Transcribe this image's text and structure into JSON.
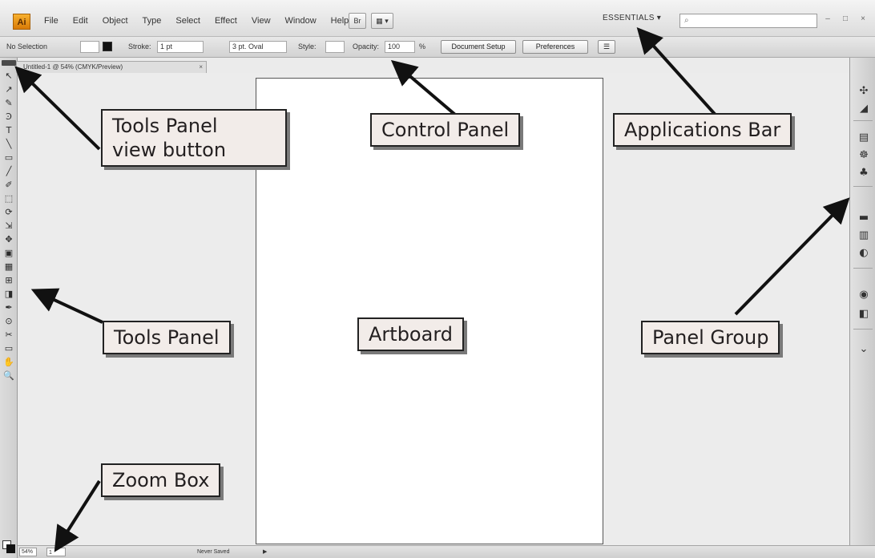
{
  "app": {
    "logo": "Ai",
    "menu": [
      "File",
      "Edit",
      "Object",
      "Type",
      "Select",
      "Effect",
      "View",
      "Window",
      "Help"
    ],
    "bridge_button": "Br",
    "arrange_button": "▦ ▾",
    "workspace": "ESSENTIALS ▾",
    "search_placeholder": "",
    "window_controls": [
      "–",
      "□",
      "×"
    ]
  },
  "control_panel": {
    "selection": "No Selection",
    "stroke_label": "Stroke:",
    "stroke_value": "1 pt",
    "brush": "3 pt. Oval",
    "style_label": "Style:",
    "opacity_label": "Opacity:",
    "opacity_value": "100",
    "opacity_unit": "%",
    "document_setup": "Document Setup",
    "preferences": "Preferences"
  },
  "document_tab": {
    "title": "Untitled-1 @ 54% (CMYK/Preview)",
    "close": "×"
  },
  "tools": [
    "↖",
    "↗",
    "✎",
    "Ͽ",
    "T",
    "╲",
    "▭",
    "╱",
    "✐",
    "⬚",
    "⟳",
    "⇲",
    "✥",
    "▣",
    "▦",
    "⊞",
    "◨",
    "✒",
    "⊙",
    "✂",
    "▭",
    "✋",
    "🔍"
  ],
  "panel_icons": [
    "✣",
    "◢",
    "▤",
    "☸",
    "♣",
    "▬",
    "▥",
    "◐",
    "◉",
    "◧",
    "⌄"
  ],
  "status_bar": {
    "zoom": "54%",
    "page": "1",
    "status": "Never Saved",
    "nav_arrow": "▶"
  },
  "callouts": {
    "tools_view_button": [
      "Tools Panel",
      "view button"
    ],
    "control_panel": "Control Panel",
    "applications_bar": "Applications Bar",
    "tools_panel": "Tools Panel",
    "artboard": "Artboard",
    "panel_group": "Panel Group",
    "zoom_box": "Zoom Box"
  },
  "colors": {
    "callout_fill": "#f2ece9",
    "callout_border": "#222222",
    "arrow": "#111111",
    "logo": "#e8900f"
  }
}
